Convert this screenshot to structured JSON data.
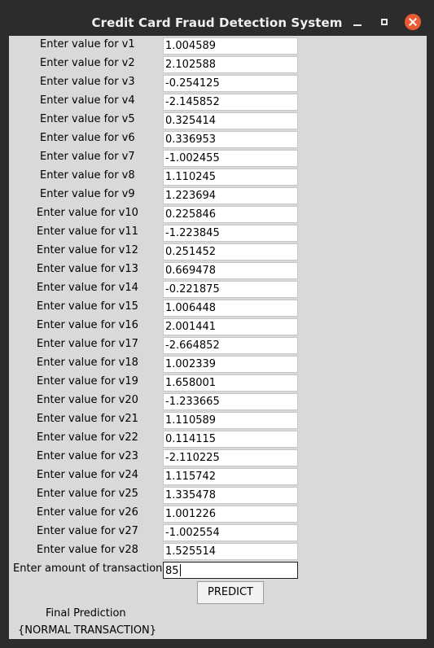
{
  "window": {
    "title": "Credit Card Fraud Detection System"
  },
  "fields": [
    {
      "label": "Enter value for v1",
      "value": "1.004589"
    },
    {
      "label": "Enter value for v2",
      "value": "2.102588"
    },
    {
      "label": "Enter value for v3",
      "value": "-0.254125"
    },
    {
      "label": "Enter value for v4",
      "value": "-2.145852"
    },
    {
      "label": "Enter value for v5",
      "value": "0.325414"
    },
    {
      "label": "Enter value for v6",
      "value": "0.336953"
    },
    {
      "label": "Enter value for v7",
      "value": "-1.002455"
    },
    {
      "label": "Enter value for v8",
      "value": "1.110245"
    },
    {
      "label": "Enter value for v9",
      "value": "1.223694"
    },
    {
      "label": "Enter value for v10",
      "value": "0.225846"
    },
    {
      "label": "Enter value for v11",
      "value": "-1.223845"
    },
    {
      "label": "Enter value for v12",
      "value": "0.251452"
    },
    {
      "label": "Enter value for v13",
      "value": "0.669478"
    },
    {
      "label": "Enter value for v14",
      "value": "-0.221875"
    },
    {
      "label": "Enter value for v15",
      "value": "1.006448"
    },
    {
      "label": "Enter value for v16",
      "value": "2.001441"
    },
    {
      "label": "Enter value for v17",
      "value": "-2.664852"
    },
    {
      "label": "Enter value for v18",
      "value": "1.002339"
    },
    {
      "label": "Enter value for v19",
      "value": "1.658001"
    },
    {
      "label": "Enter value for v20",
      "value": "-1.233665"
    },
    {
      "label": "Enter value for v21",
      "value": "1.110589"
    },
    {
      "label": "Enter value for v22",
      "value": "0.114115"
    },
    {
      "label": "Enter value for v23",
      "value": "-2.110225"
    },
    {
      "label": "Enter value for v24",
      "value": "1.115742"
    },
    {
      "label": "Enter value for v25",
      "value": "1.335478"
    },
    {
      "label": "Enter value for v26",
      "value": "1.001226"
    },
    {
      "label": "Enter value for v27",
      "value": "-1.002554"
    },
    {
      "label": "Enter value for v28",
      "value": "1.525514"
    }
  ],
  "amount": {
    "label": "Enter amount of transaction",
    "value": "85"
  },
  "predict_button": {
    "label": "PREDICT"
  },
  "result": {
    "heading": "Final Prediction",
    "value": "{NORMAL TRANSACTION}"
  },
  "icons": {
    "minimize": "minimize-icon",
    "maximize": "maximize-icon",
    "close": "close-icon"
  },
  "colors": {
    "titlebar": "#2c2c2c",
    "content_bg": "#d9d9d9",
    "close_button": "#ea5a33"
  }
}
